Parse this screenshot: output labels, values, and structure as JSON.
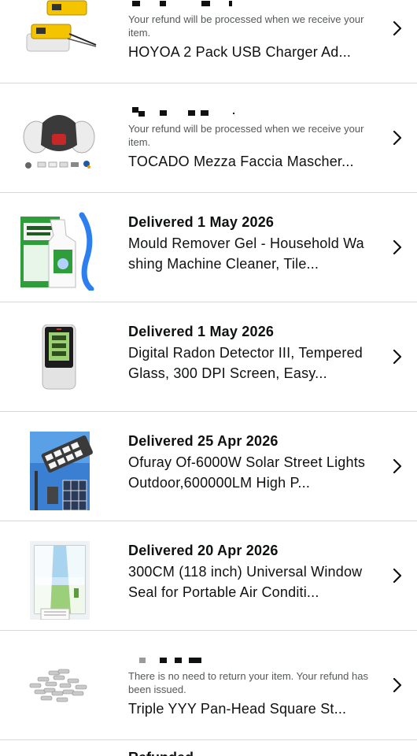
{
  "orders": [
    {
      "status": "",
      "note": "Your refund will be processed when we receive your item.",
      "title": "HOYOA 2 Pack USB Charger Ad...",
      "thumb_icon": "usb-charger-adapter-image"
    },
    {
      "status": "",
      "note": "Your refund will be processed when we receive your item.",
      "title": "TOCADO Mezza Faccia Mascher...",
      "thumb_icon": "half-face-respirator-mask-image"
    },
    {
      "status": "Delivered 1 May 2026",
      "note": "",
      "title": "Mould Remover Gel - Household Washing Machine Cleaner, Tile...",
      "thumb_icon": "mould-remover-gel-image"
    },
    {
      "status": "Delivered 1 May 2026",
      "note": "",
      "title": "Digital Radon Detector III, Tempered Glass, 300 DPI Screen, Easy...",
      "thumb_icon": "radon-detector-image"
    },
    {
      "status": "Delivered 25 Apr 2026",
      "note": "",
      "title": "Ofuray Of-6000W Solar Street Lights Outdoor,600000LM High P...",
      "thumb_icon": "solar-street-light-image"
    },
    {
      "status": "Delivered 20 Apr 2026",
      "note": "",
      "title": "300CM (118 inch) Universal Window Seal for Portable Air Conditi...",
      "thumb_icon": "window-seal-image"
    },
    {
      "status": "",
      "note": "There is no need to return your item. Your refund has been issued.",
      "title": "Triple YYY Pan-Head Square St...",
      "thumb_icon": "screws-pile-image"
    }
  ],
  "peek_status": "Refunded",
  "chevron_icon": "chevron-right-icon",
  "colors": {
    "text": "#0f1111",
    "secondary": "#565959",
    "divider": "#d5d9d9"
  }
}
